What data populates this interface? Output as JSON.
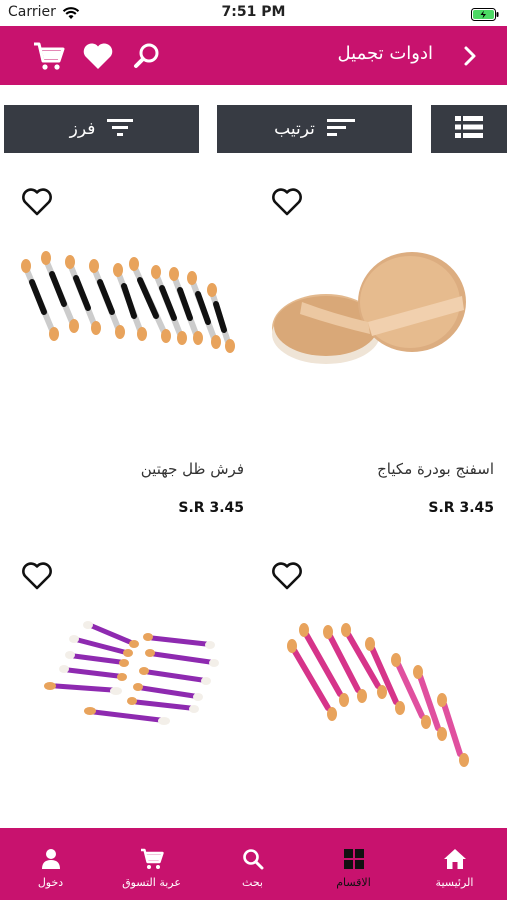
{
  "status_bar": {
    "carrier": "Carrier",
    "time": "7:51 PM"
  },
  "header": {
    "title": "ادوات تجميل"
  },
  "filters": {
    "sort_label": "ترتيب",
    "filter_label": "فرز"
  },
  "products": [
    {
      "name": "اسفنج بودرة مكياج",
      "price": "S.R 3.45",
      "image": "powder-puff-sponge-image"
    },
    {
      "name": "فرش ظل جهتين",
      "price": "S.R 3.45",
      "image": "double-ended-shadow-brushes-image"
    },
    {
      "name": "",
      "price": "",
      "image": "pink-eyeshadow-applicators-image"
    },
    {
      "name": "",
      "price": "",
      "image": "purple-eyeshadow-applicators-image"
    }
  ],
  "tabbar": {
    "home": "الرئيسية",
    "categories": "الاقسام",
    "search": "بحث",
    "cart": "عربة التسوق",
    "login": "دخول"
  },
  "colors": {
    "brand": "#c8126e",
    "filter_bg": "#373b43",
    "active_tab_label": "#111111"
  }
}
